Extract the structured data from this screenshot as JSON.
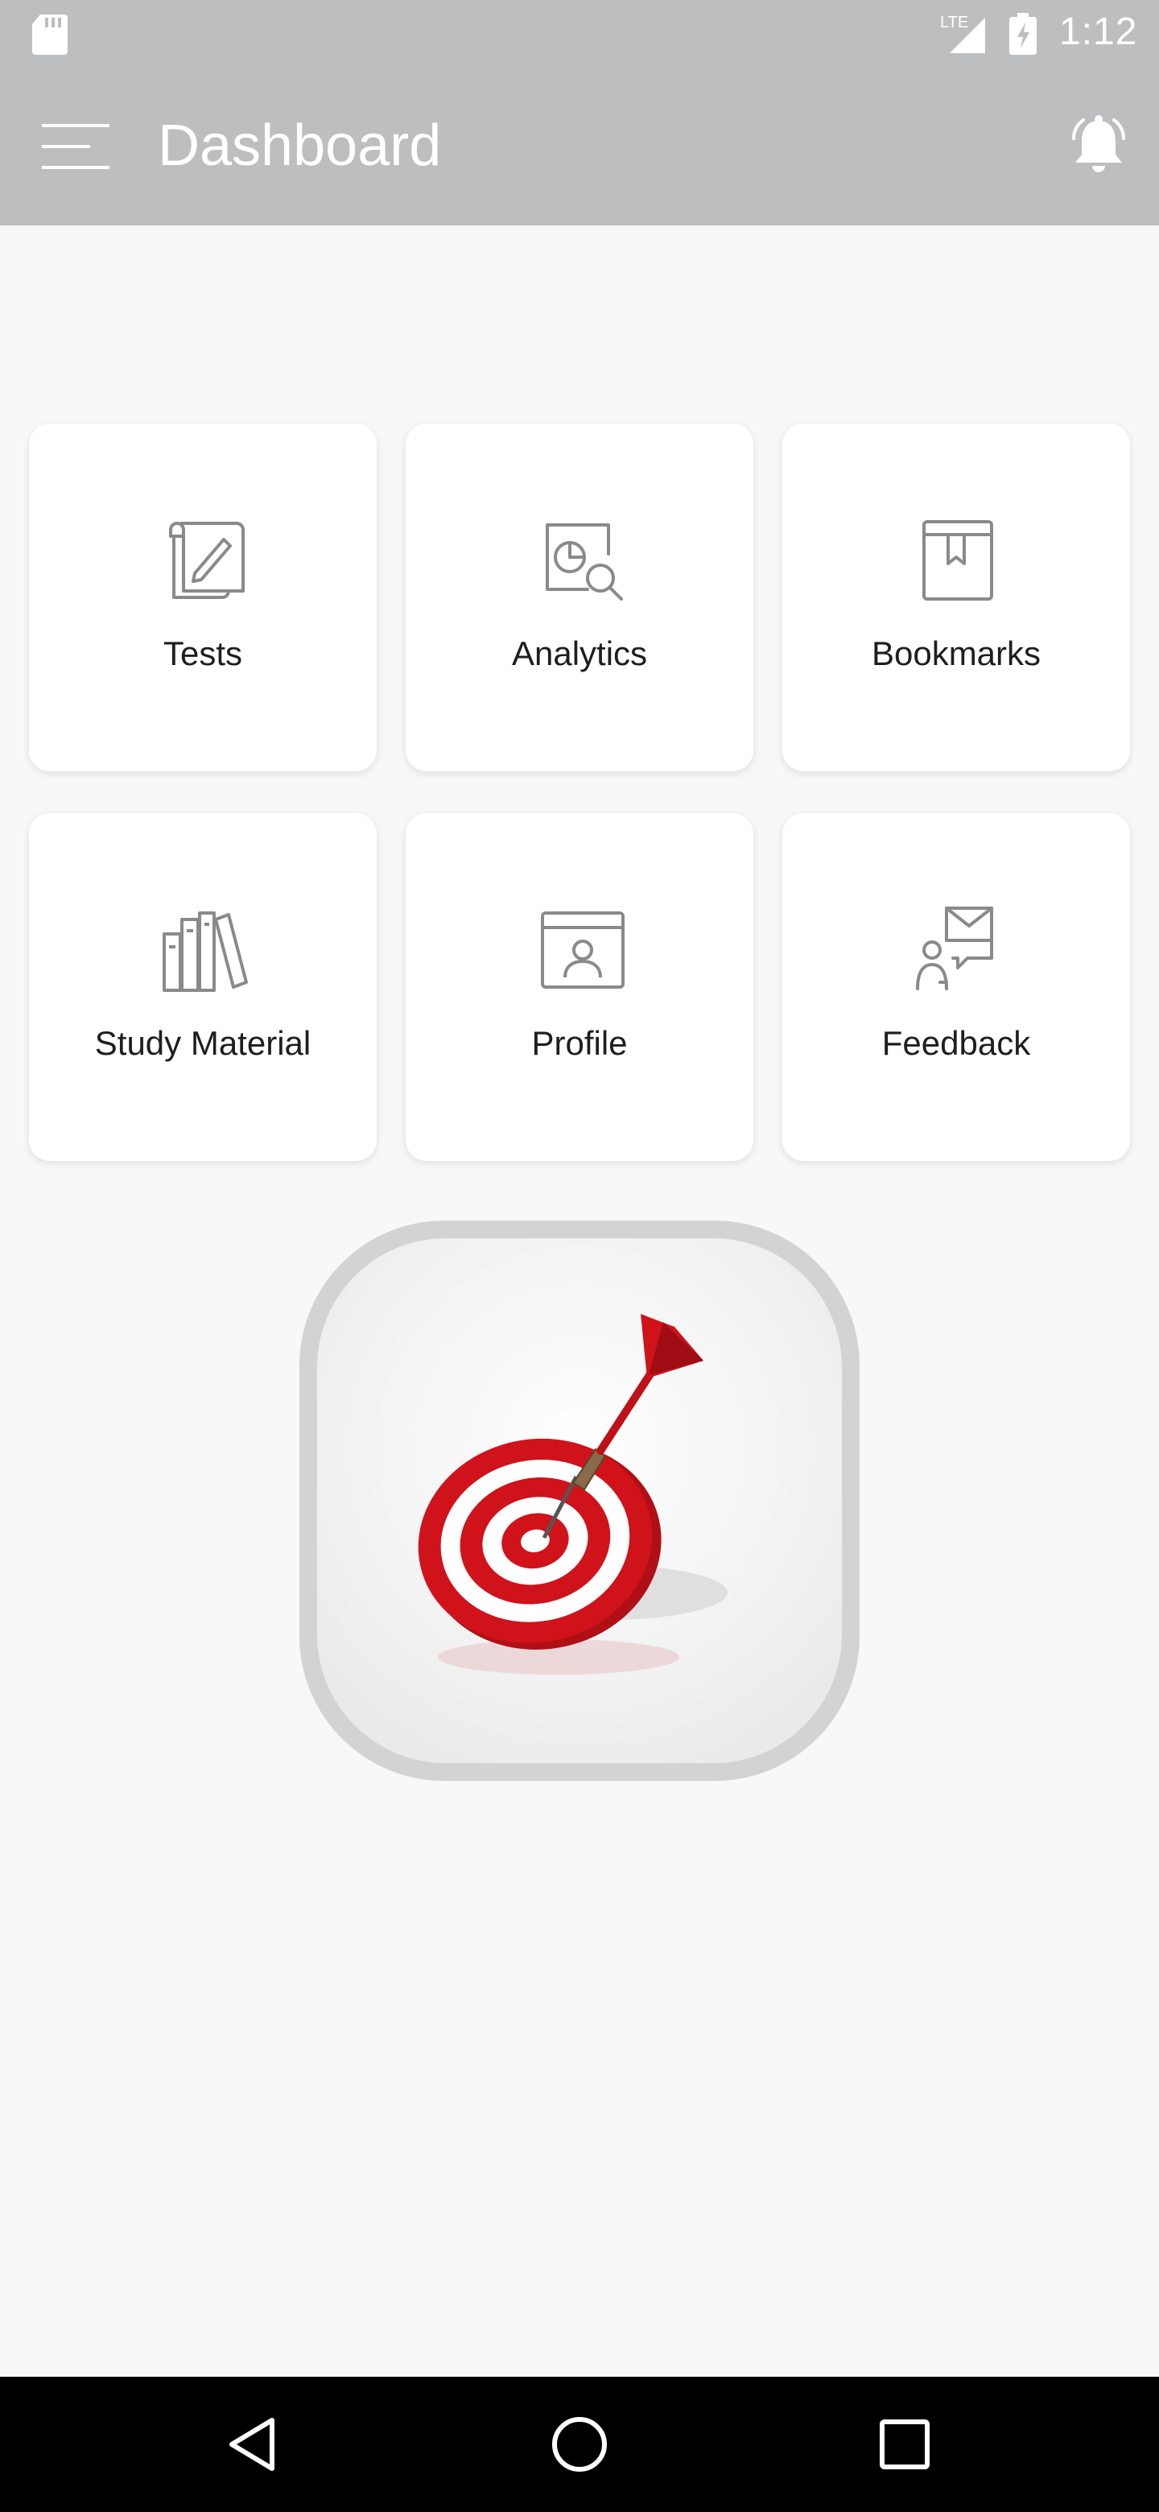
{
  "status_bar": {
    "network": "LTE",
    "time": "1:12",
    "icons": [
      "sd-card-icon",
      "signal-icon",
      "battery-charging-icon"
    ]
  },
  "app_bar": {
    "title": "Dashboard",
    "menu_icon": "menu-icon",
    "notification_icon": "bell-icon"
  },
  "tiles": [
    {
      "label": "Tests",
      "icon": "test-paper-icon"
    },
    {
      "label": "Analytics",
      "icon": "analytics-search-icon"
    },
    {
      "label": "Bookmarks",
      "icon": "bookmark-book-icon"
    },
    {
      "label": "Study Material",
      "icon": "books-icon"
    },
    {
      "label": "Profile",
      "icon": "profile-card-icon"
    },
    {
      "label": "Feedback",
      "icon": "feedback-chat-icon"
    }
  ],
  "logo": {
    "icon": "dart-target-icon"
  },
  "nav_bar": {
    "icons": [
      "back-icon",
      "home-icon",
      "recents-icon"
    ]
  },
  "colors": {
    "app_bar": "#bdbebf",
    "background": "#f8f8f8",
    "card": "#ffffff",
    "icon_gray": "#8a8a8a",
    "target_red": "#d0121b"
  }
}
